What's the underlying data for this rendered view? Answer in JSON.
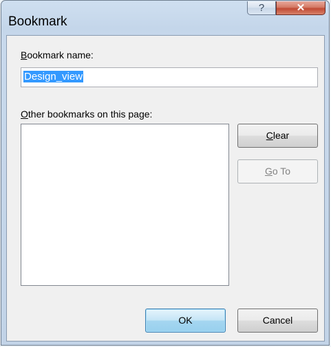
{
  "window": {
    "title": "Bookmark",
    "help_glyph": "?",
    "close_glyph": "✕"
  },
  "bookmark_name": {
    "label_mnemonic": "B",
    "label_rest": "ookmark name:",
    "value": "Design_view"
  },
  "other_bookmarks": {
    "label_mnemonic": "O",
    "label_rest": "ther bookmarks on this page:",
    "items": []
  },
  "buttons": {
    "clear_mnemonic": "C",
    "clear_rest": "lear",
    "goto_mnemonic": "G",
    "goto_rest": "o To",
    "ok": "OK",
    "cancel": "Cancel"
  },
  "icons": {
    "help": "help-icon",
    "close": "close-icon"
  }
}
